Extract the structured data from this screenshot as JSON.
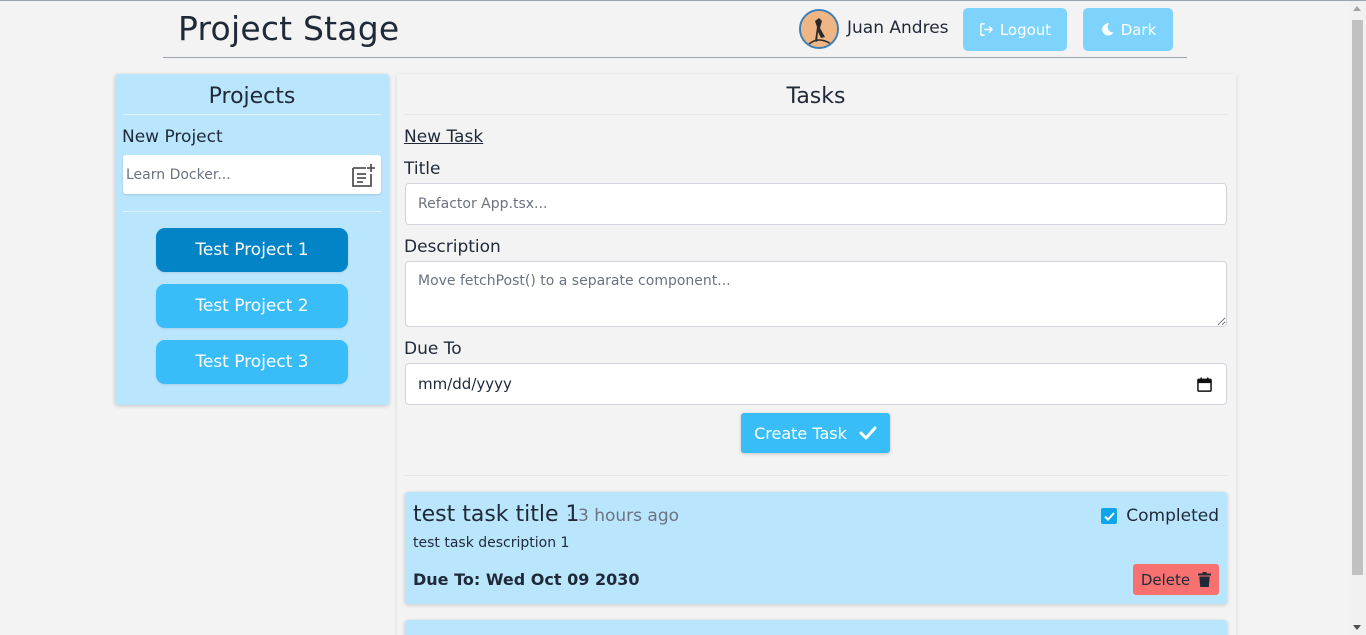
{
  "header": {
    "app_title": "Project Stage",
    "user_name": "Juan Andres",
    "logout_label": "Logout",
    "dark_label": "Dark"
  },
  "projects": {
    "title": "Projects",
    "new_project_label": "New Project",
    "input_placeholder": "Learn Docker...",
    "items": [
      {
        "label": "Test Project 1",
        "active": true
      },
      {
        "label": "Test Project 2",
        "active": false
      },
      {
        "label": "Test Project 3",
        "active": false
      }
    ]
  },
  "tasks": {
    "title": "Tasks",
    "new_task_label": "New Task",
    "form": {
      "title_label": "Title",
      "title_placeholder": "Refactor App.tsx...",
      "description_label": "Description",
      "description_placeholder": "Move fetchPost() to a separate component...",
      "due_label": "Due To",
      "due_placeholder": "mm/dd/yyyy",
      "create_label": "Create Task"
    },
    "items": [
      {
        "title": "test task title 1",
        "separator": "·",
        "time_ago": "3 hours ago",
        "description": "test task description 1",
        "due": "Due To: Wed Oct 09 2030",
        "completed": true,
        "completed_label": "Completed",
        "delete_label": "Delete"
      }
    ]
  },
  "colors": {
    "accent": "#38bdf8",
    "accent_active": "#0284c7",
    "panel_bg": "#bae6fd",
    "delete_bg": "#f87171",
    "header_button_bg": "#7dd3fc"
  },
  "icons": {
    "logout": "logout-icon",
    "dark": "moon-icon",
    "add_project": "note-add-icon",
    "create_task": "check-icon",
    "completed": "checkbox-checked-icon",
    "delete": "trash-icon",
    "date": "calendar-icon"
  }
}
